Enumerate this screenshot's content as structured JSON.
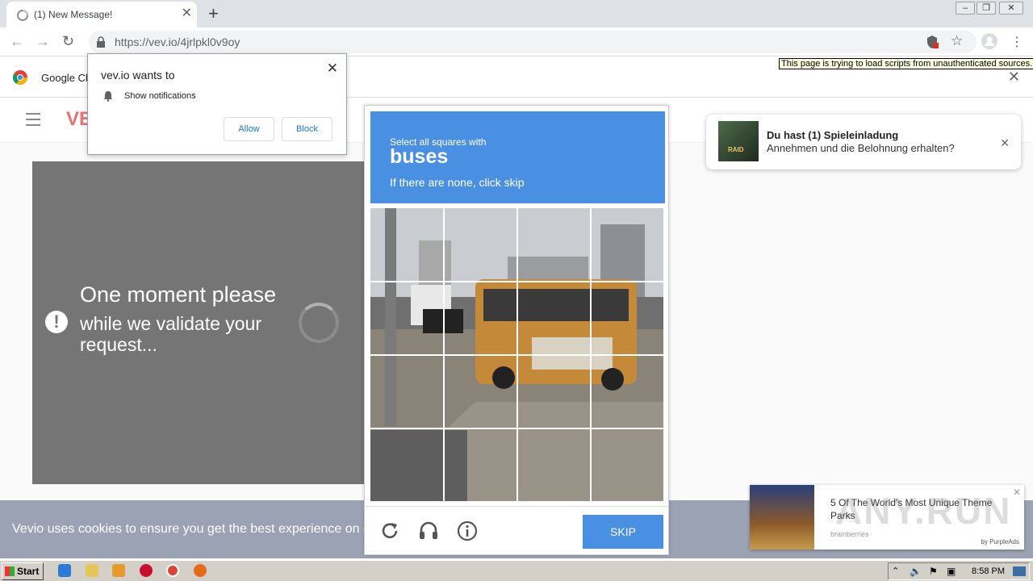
{
  "browser": {
    "tab_title": "(1) New Message!",
    "new_tab_label": "+",
    "url": "https://vev.io/4jrlpkl0v9oy",
    "security_tooltip": "This page is trying to load scripts from unauthenticated sources.",
    "infobar_text": "Google Ch"
  },
  "permission_popup": {
    "title": "vev.io wants to",
    "permission": "Show notifications",
    "allow_label": "Allow",
    "block_label": "Block"
  },
  "site": {
    "logo": "VE",
    "validate_title": "One moment please",
    "validate_sub": "while we validate your request...",
    "cookie_text": "Vevio uses cookies to ensure you get the best experience on o"
  },
  "captcha": {
    "instruction": "Select all squares with",
    "target": "buses",
    "hint": "If there are none, click skip",
    "skip_label": "SKIP",
    "accent": "#4a90e2"
  },
  "game_notification": {
    "thumb_text": "RAID",
    "title": "Du hast (1) Spieleinladung",
    "message": "Annehmen und die Belohnung erhalten?"
  },
  "ad": {
    "title": "5 Of The World's Most Unique Theme Parks",
    "source": "brainberries",
    "by": "by PurpleAds"
  },
  "watermark": "ANY.RUN",
  "taskbar": {
    "start_label": "Start",
    "clock": "8:58 PM"
  }
}
